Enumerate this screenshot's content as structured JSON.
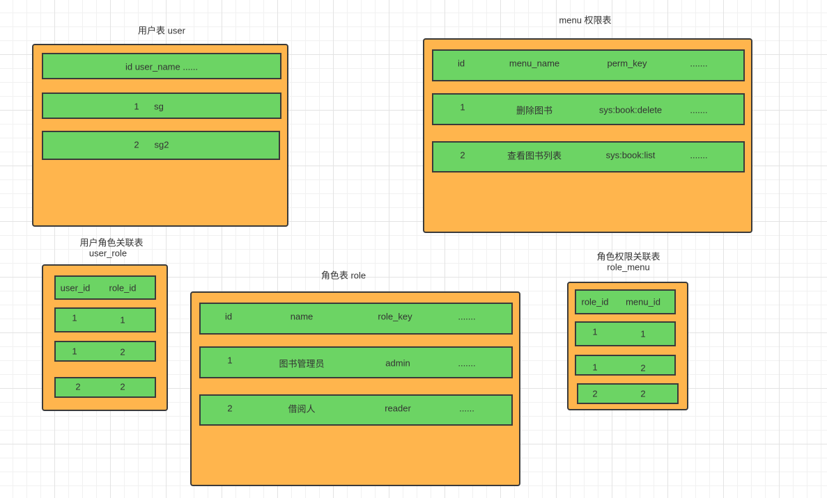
{
  "tables": [
    {
      "id": "user",
      "title": [
        "用户表  user"
      ],
      "rows": [
        [
          "id user_name ......"
        ],
        [
          "1",
          "sg"
        ],
        [
          "2",
          "sg2"
        ]
      ]
    },
    {
      "id": "menu",
      "title": [
        "menu 权限表"
      ],
      "rows": [
        [
          "id",
          "menu_name",
          "perm_key",
          "......."
        ],
        [
          "1",
          "删除图书",
          "sys:book:delete",
          "......."
        ],
        [
          "2",
          "查看图书列表",
          "sys:book:list",
          "......."
        ]
      ]
    },
    {
      "id": "user-role",
      "title": [
        "用户角色关联表",
        "user_role"
      ],
      "rows": [
        [
          "user_id",
          "role_id"
        ],
        [
          "1",
          "1"
        ],
        [
          "1",
          "2"
        ],
        [
          "2",
          "2"
        ]
      ]
    },
    {
      "id": "role",
      "title": [
        "角色表   role"
      ],
      "rows": [
        [
          "id",
          "name",
          "role_key",
          "......."
        ],
        [
          "1",
          "图书管理员",
          "admin",
          "......."
        ],
        [
          "2",
          "借阅人",
          "reader",
          "......"
        ]
      ]
    },
    {
      "id": "role-menu",
      "title": [
        "角色权限关联表",
        "role_menu"
      ],
      "rows": [
        [
          "role_id",
          "menu_id"
        ],
        [
          "1",
          "1"
        ],
        [
          "1",
          "2"
        ],
        [
          "2",
          "2"
        ]
      ]
    }
  ],
  "colors": {
    "table": "#ffb54d",
    "row": "#6cd464",
    "border": "#3a3a3a"
  }
}
